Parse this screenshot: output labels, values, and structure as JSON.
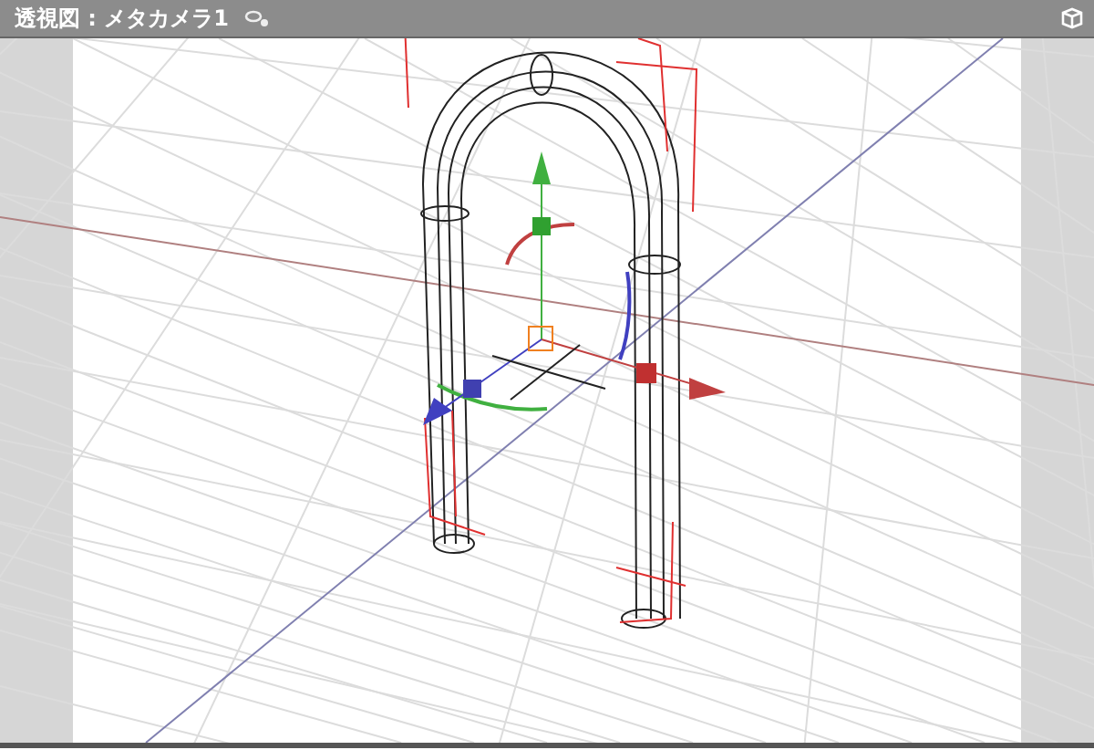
{
  "viewport": {
    "title": "透視図 : メタカメラ1"
  }
}
